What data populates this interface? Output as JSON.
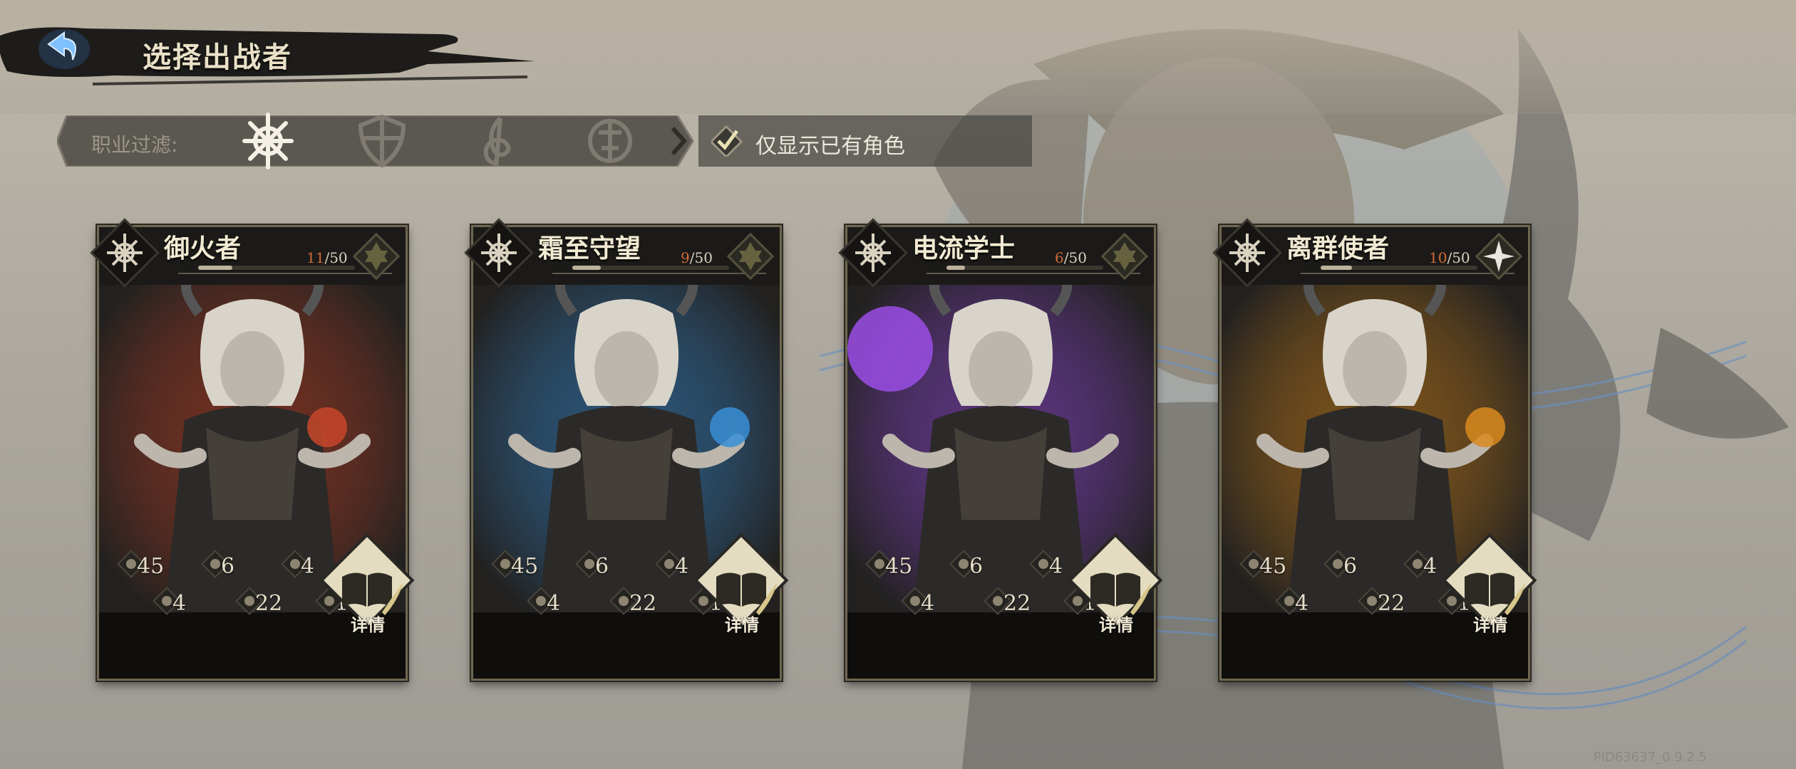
{
  "header": {
    "title": "选择出战者",
    "back_icon": "back-arrow-icon"
  },
  "filter": {
    "label": "职业过滤:",
    "classes": [
      {
        "icon": "rune-emblem-icon",
        "active": true
      },
      {
        "icon": "shield-emblem-icon",
        "active": false
      },
      {
        "icon": "music-clef-icon",
        "active": false
      },
      {
        "icon": "sun-compass-icon",
        "active": false
      }
    ],
    "owned_only_label": "仅显示已有角色",
    "owned_only_checked": true
  },
  "cards": [
    {
      "name": "御火者",
      "level": "11",
      "level_max": "/50",
      "level_fraction": 0.22,
      "element_icon": "hexagram-rune-icon",
      "theme": "#c8462a",
      "stats": [
        "45",
        "6",
        "4",
        "4",
        "22",
        "12"
      ],
      "detail_label": "详情"
    },
    {
      "name": "霜至守望",
      "level": "9",
      "level_max": "/50",
      "level_fraction": 0.18,
      "element_icon": "hexagram-rune-icon",
      "theme": "#3a8fd6",
      "stats": [
        "45",
        "6",
        "4",
        "4",
        "22",
        "12"
      ],
      "detail_label": "详情"
    },
    {
      "name": "电流学士",
      "level": "6",
      "level_max": "/50",
      "level_fraction": 0.12,
      "element_icon": "hexagram-rune-icon",
      "theme": "#9b4ee6",
      "stats": [
        "45",
        "6",
        "4",
        "4",
        "22",
        "12"
      ],
      "detail_label": "详情"
    },
    {
      "name": "离群使者",
      "level": "10",
      "level_max": "/50",
      "level_fraction": 0.2,
      "element_icon": "white-star-icon",
      "theme": "#d98a1e",
      "stats": [
        "45",
        "6",
        "4",
        "4",
        "22",
        "12"
      ],
      "detail_label": "详情"
    }
  ],
  "footer": {
    "build_id": "PID63637_0.9.2.5"
  }
}
